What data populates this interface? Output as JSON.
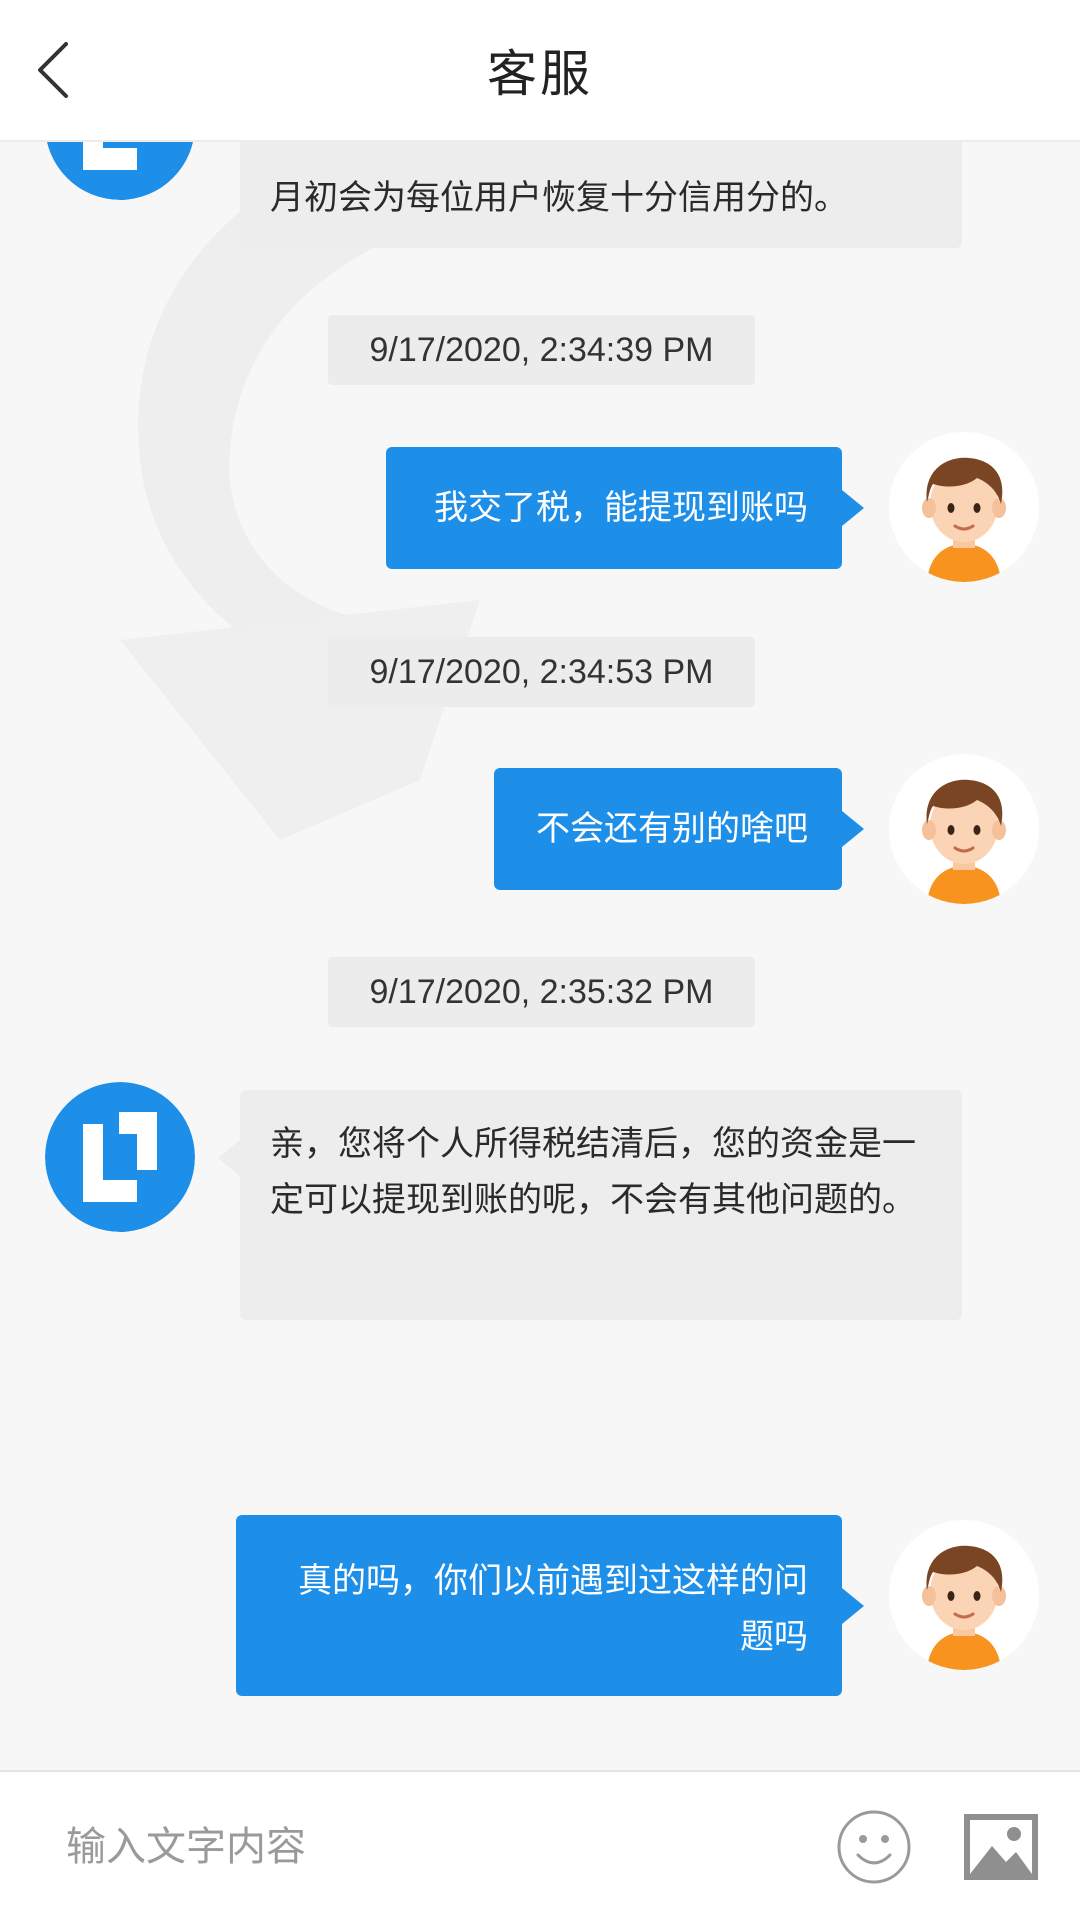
{
  "header": {
    "title": "客服"
  },
  "messages": {
    "m0": {
      "text": "月初会为每位用户恢复十分信用分的。"
    },
    "ts1": "9/17/2020, 2:34:39 PM",
    "m1": {
      "text": "我交了税，能提现到账吗"
    },
    "ts2": "9/17/2020, 2:34:53 PM",
    "m2": {
      "text": "不会还有别的啥吧"
    },
    "ts3": "9/17/2020, 2:35:32 PM",
    "m3": {
      "text": "亲，您将个人所得税结清后，您的资金是一定可以提现到账的呢，不会有其他问题的。"
    },
    "m4": {
      "text": "真的吗，你们以前遇到过这样的问题吗"
    }
  },
  "input": {
    "placeholder": "输入文字内容"
  },
  "icons": {
    "back": "chevron-left-icon",
    "emoji": "smiley-icon",
    "image": "image-icon",
    "agent_avatar": "service-logo-icon",
    "user_avatar": "boy-avatar-icon"
  },
  "colors": {
    "accent_blue": "#1e8fe9",
    "incoming_bubble": "#ededed",
    "background": "#f7f7f7"
  }
}
